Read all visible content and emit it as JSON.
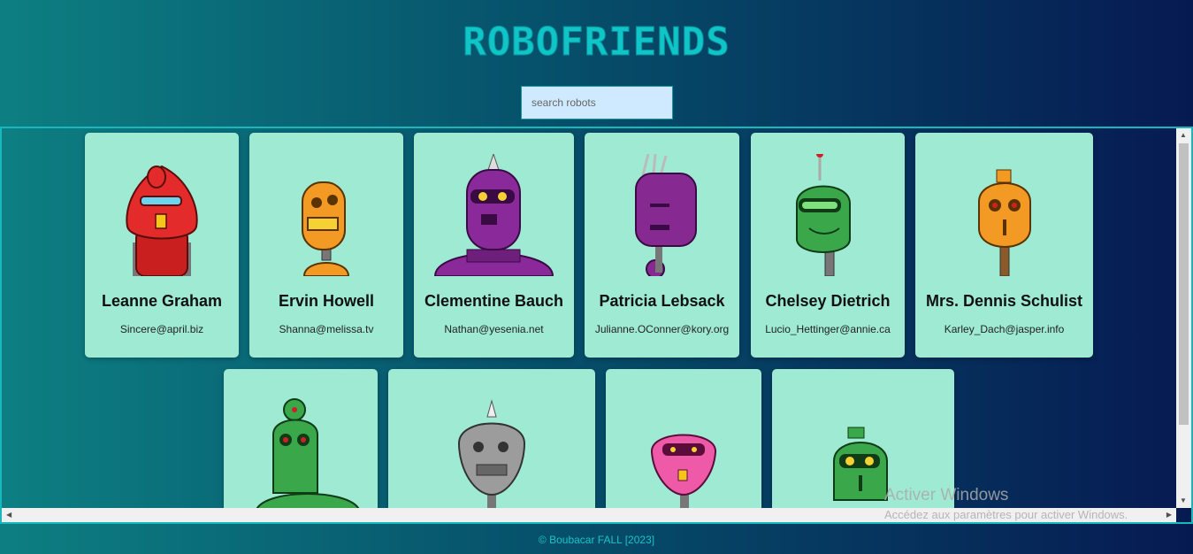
{
  "app": {
    "title": "ROBOFRIENDS"
  },
  "search": {
    "placeholder": "search robots",
    "value": ""
  },
  "robots": [
    {
      "name": "Leanne Graham",
      "email": "Sincere@april.biz",
      "color": "#e32b2b"
    },
    {
      "name": "Ervin Howell",
      "email": "Shanna@melissa.tv",
      "color": "#f29a24"
    },
    {
      "name": "Clementine Bauch",
      "email": "Nathan@yesenia.net",
      "color": "#8a2a9a"
    },
    {
      "name": "Patricia Lebsack",
      "email": "Julianne.OConner@kory.org",
      "color": "#862a92"
    },
    {
      "name": "Chelsey Dietrich",
      "email": "Lucio_Hettinger@annie.ca",
      "color": "#3aa84a"
    },
    {
      "name": "Mrs. Dennis Schulist",
      "email": "Karley_Dach@jasper.info",
      "color": "#f29a24"
    },
    {
      "name": "",
      "email": "",
      "color": "#3aa84a"
    },
    {
      "name": "",
      "email": "",
      "color": "#9c9c9c"
    },
    {
      "name": "",
      "email": "",
      "color": "#ee5aa8"
    },
    {
      "name": "",
      "email": "",
      "color": "#3aa84a"
    }
  ],
  "footer": {
    "text": "© Boubacar FALL [2023]"
  },
  "watermark": {
    "line1": "Activer Windows",
    "line2": "Accédez aux paramètres pour activer Windows."
  }
}
